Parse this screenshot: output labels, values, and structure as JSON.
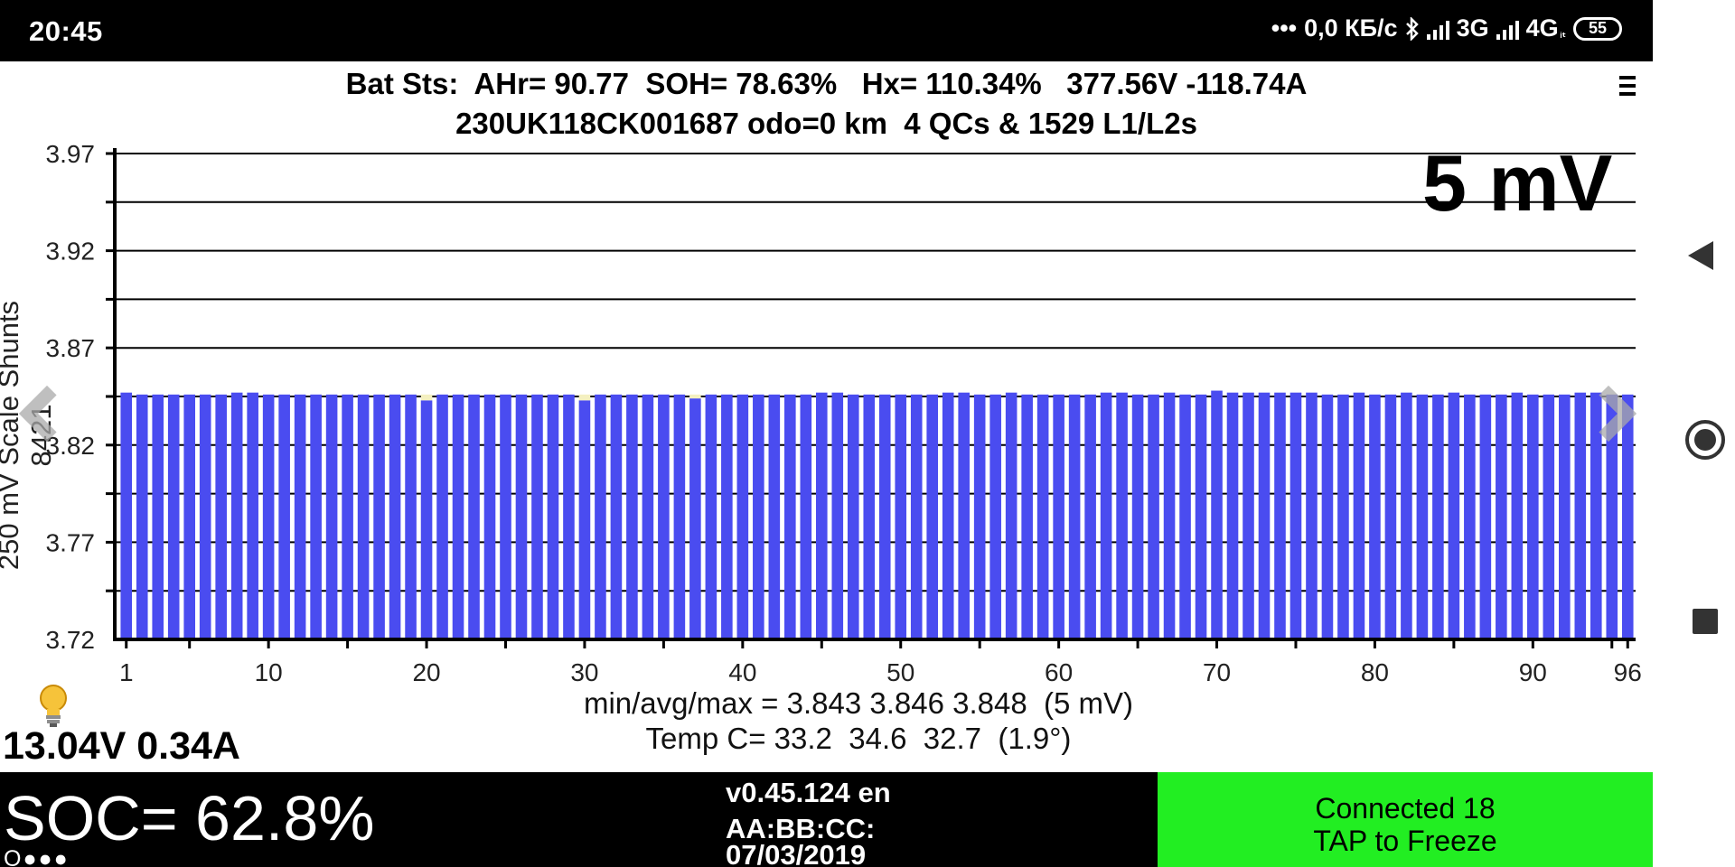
{
  "status_bar": {
    "time": "20:45",
    "dots": "•••",
    "data_rate": "0,0 КБ/с",
    "network_1": "3G",
    "network_2": "4G",
    "tiny": "ᵢₜ",
    "battery": "55"
  },
  "header": {
    "line1": "Bat Sts:  AHr= 90.77  SOH= 78.63%   Hx= 110.34%   377.56V -118.74A",
    "line2": "230UK118CK001687 odo=0 km  4 QCs & 1529 L1/L2s",
    "scale_badge": "5 mV"
  },
  "chart_data": {
    "type": "bar",
    "ylabel": "250 mV Scale  Shunts 8421",
    "ylim": [
      3.72,
      3.97
    ],
    "yticks": [
      3.72,
      3.77,
      3.82,
      3.87,
      3.92,
      3.97
    ],
    "ytick_labels": [
      "3.72",
      "3.77",
      "3.82",
      "3.87",
      "3.92",
      "3.97"
    ],
    "xticks": [
      1,
      10,
      20,
      30,
      40,
      50,
      60,
      70,
      80,
      90,
      96
    ],
    "xtick_labels": [
      "1",
      "10",
      "20",
      "30",
      "40",
      "50",
      "60",
      "70",
      "80",
      "90",
      "96"
    ],
    "colors": {
      "bar": "#4a4cf0",
      "shunt": "#f4f0c0"
    },
    "values": [
      3.847,
      3.846,
      3.846,
      3.846,
      3.846,
      3.846,
      3.846,
      3.847,
      3.847,
      3.846,
      3.846,
      3.846,
      3.846,
      3.846,
      3.846,
      3.846,
      3.846,
      3.846,
      3.846,
      3.843,
      3.846,
      3.846,
      3.846,
      3.846,
      3.846,
      3.846,
      3.846,
      3.846,
      3.846,
      3.843,
      3.846,
      3.846,
      3.846,
      3.846,
      3.846,
      3.846,
      3.844,
      3.846,
      3.846,
      3.846,
      3.846,
      3.846,
      3.846,
      3.846,
      3.847,
      3.847,
      3.846,
      3.846,
      3.846,
      3.846,
      3.846,
      3.846,
      3.847,
      3.847,
      3.846,
      3.846,
      3.847,
      3.846,
      3.846,
      3.846,
      3.846,
      3.846,
      3.847,
      3.847,
      3.846,
      3.846,
      3.847,
      3.846,
      3.846,
      3.848,
      3.847,
      3.847,
      3.847,
      3.847,
      3.847,
      3.847,
      3.846,
      3.846,
      3.847,
      3.846,
      3.846,
      3.847,
      3.846,
      3.846,
      3.847,
      3.846,
      3.846,
      3.846,
      3.847,
      3.846,
      3.846,
      3.846,
      3.847,
      3.847,
      3.846,
      3.846
    ],
    "shunts": [
      20,
      30,
      37
    ]
  },
  "footer": {
    "stats_line1": "min/avg/max = 3.843 3.846 3.848  (5 mV)",
    "stats_line2": "Temp C= 33.2  34.6  32.7  (1.9°)",
    "aux_battery": "13.04V 0.34A"
  },
  "bottom_bar": {
    "soc": "SOC= 62.8%",
    "dots": "O●●●",
    "version": "v0.45.124 en",
    "mac": "AA:BB:CC:",
    "date": "07/03/2019",
    "connected": "Connected 18",
    "tap": "TAP to Freeze",
    "connect_color": "#22ee22"
  }
}
